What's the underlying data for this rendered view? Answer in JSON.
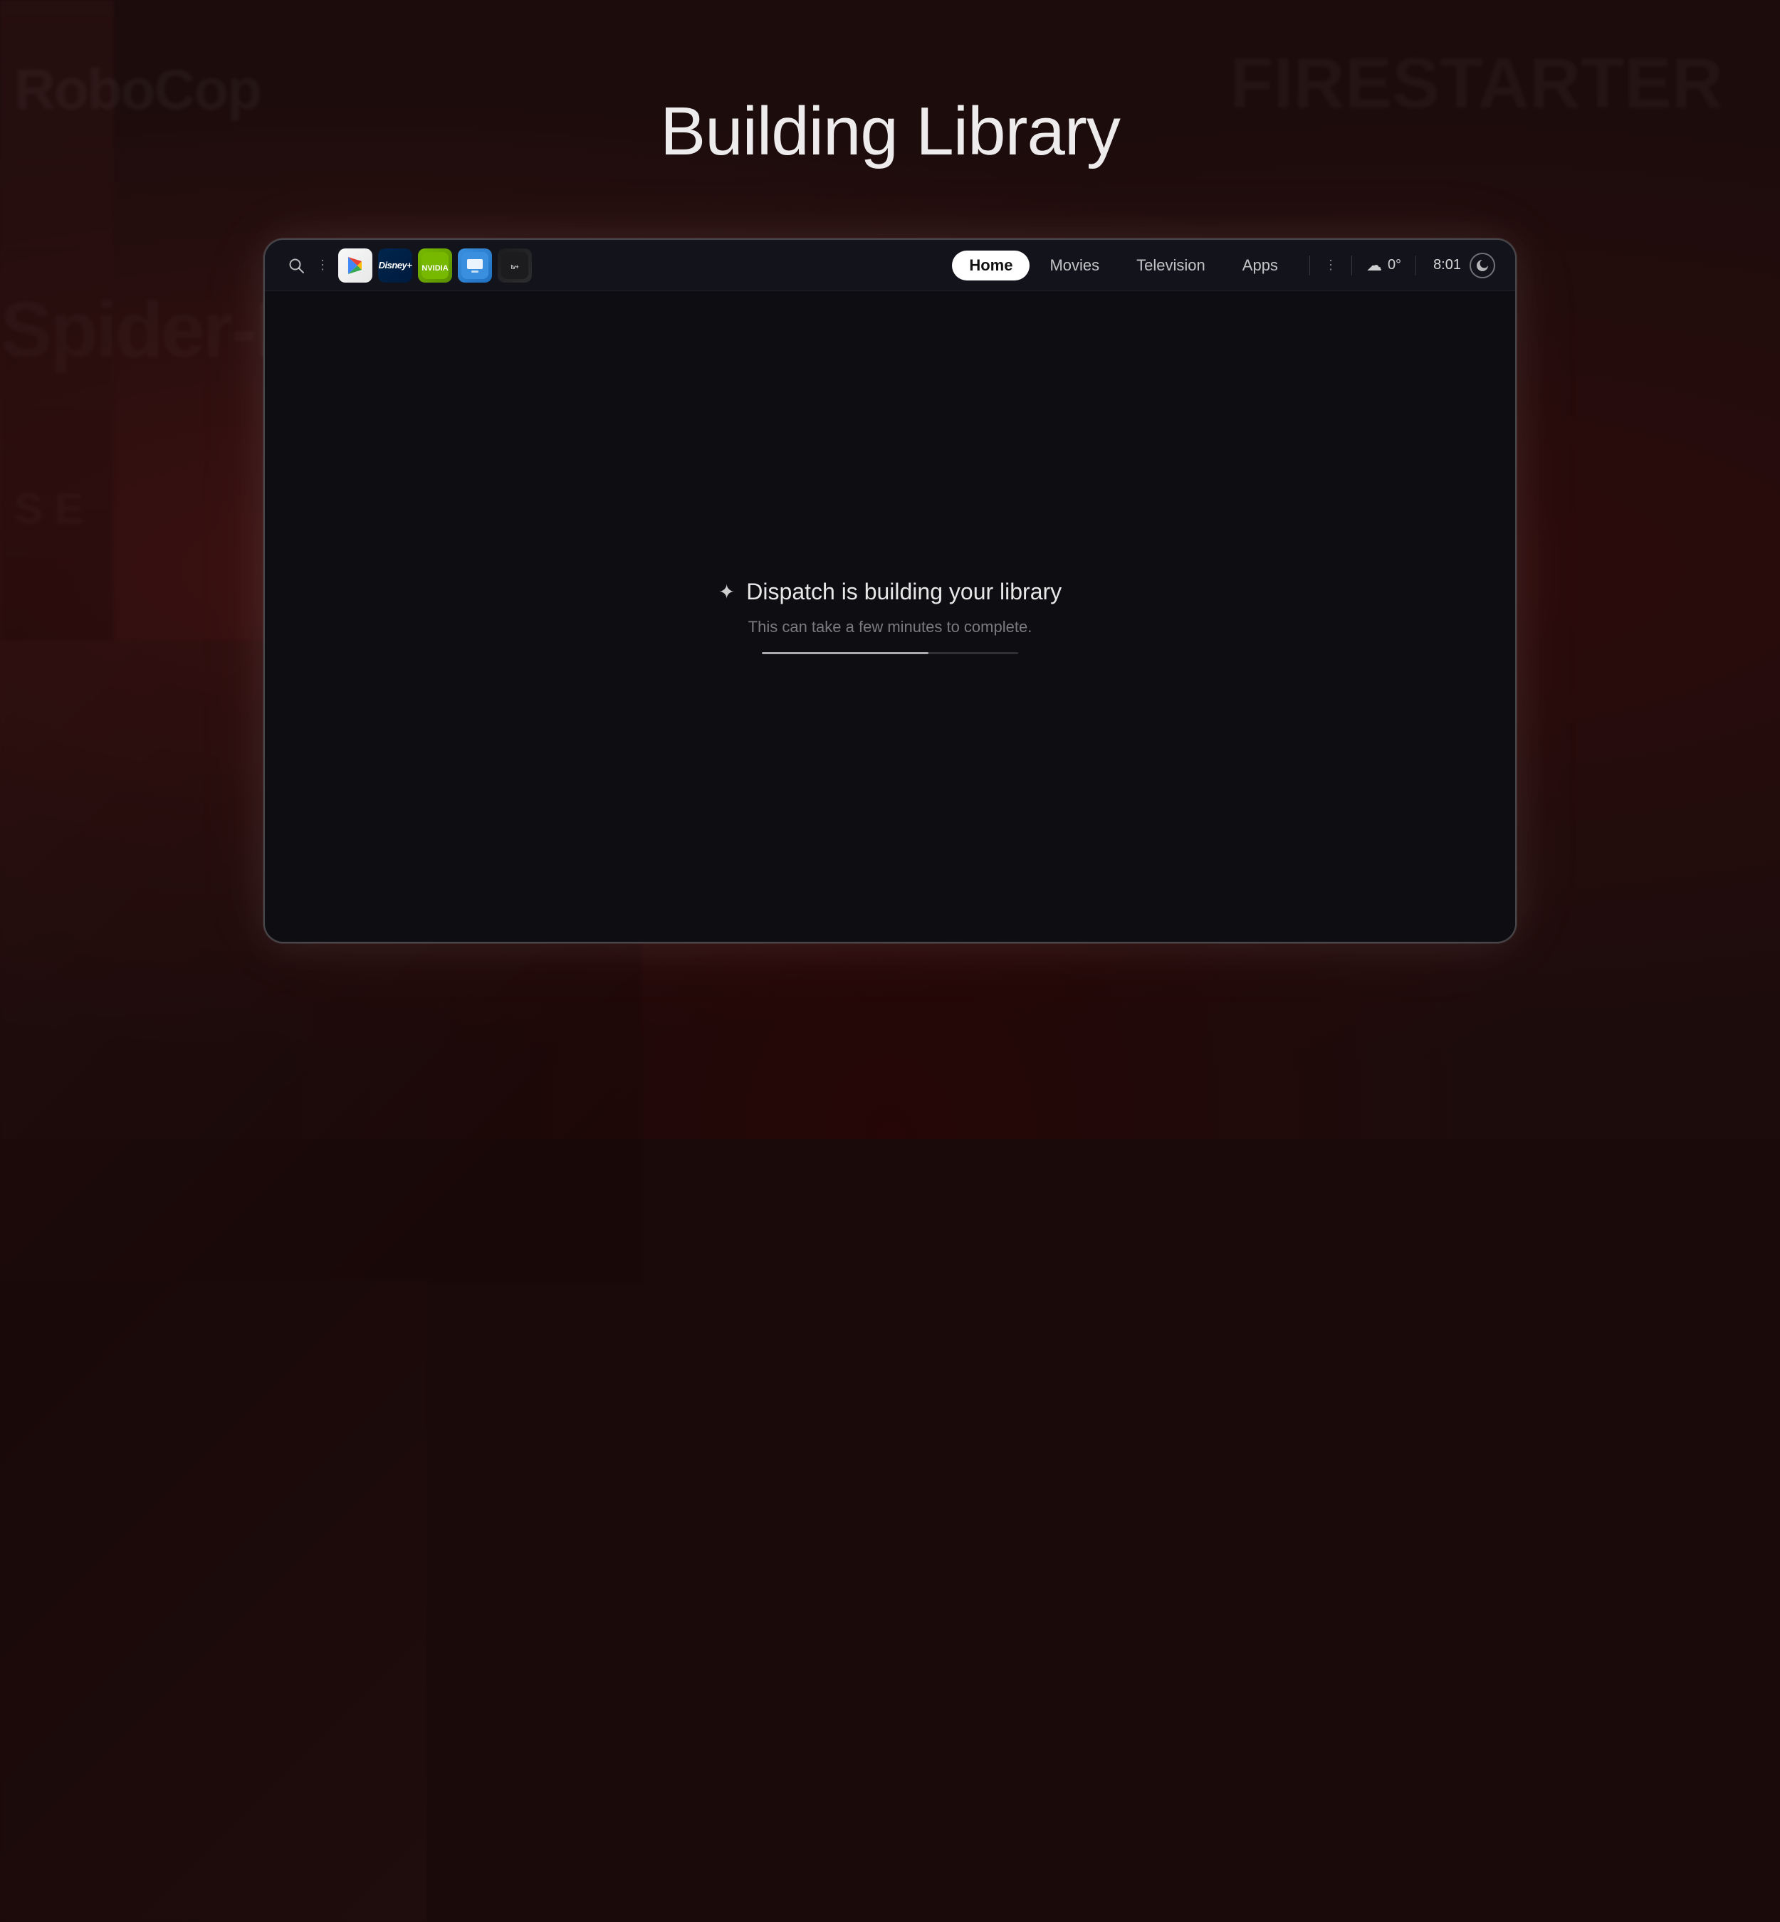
{
  "page": {
    "title": "Building Library",
    "background": {
      "color": "#1c0c0c"
    }
  },
  "bg_text": {
    "text1": "RoboCop",
    "text2": "Spider-Man",
    "text3": "S E",
    "text_right": "FIRESTARTER"
  },
  "nav": {
    "search_label": "search",
    "dots_label": "more",
    "app_icons": [
      {
        "id": "google-play",
        "label": "Google Play"
      },
      {
        "id": "disney-plus",
        "label": "Disney+"
      },
      {
        "id": "nvidia",
        "label": "NVIDIA GeForce NOW"
      },
      {
        "id": "tv",
        "label": "TV"
      },
      {
        "id": "apple-tv",
        "label": "Apple TV"
      }
    ],
    "pills": [
      {
        "id": "home",
        "label": "Home",
        "active": true
      },
      {
        "id": "movies",
        "label": "Movies",
        "active": false
      },
      {
        "id": "television",
        "label": "Television",
        "active": false
      },
      {
        "id": "apps",
        "label": "Apps",
        "active": false
      }
    ],
    "weather": {
      "icon": "☁",
      "temp": "0°"
    },
    "time": "8:01",
    "sleep_icon": "↺"
  },
  "main": {
    "building_title": "Dispatch is building your library",
    "building_subtitle": "This can take a few minutes to complete.",
    "progress_percent": 65,
    "sparkle": "✦"
  }
}
